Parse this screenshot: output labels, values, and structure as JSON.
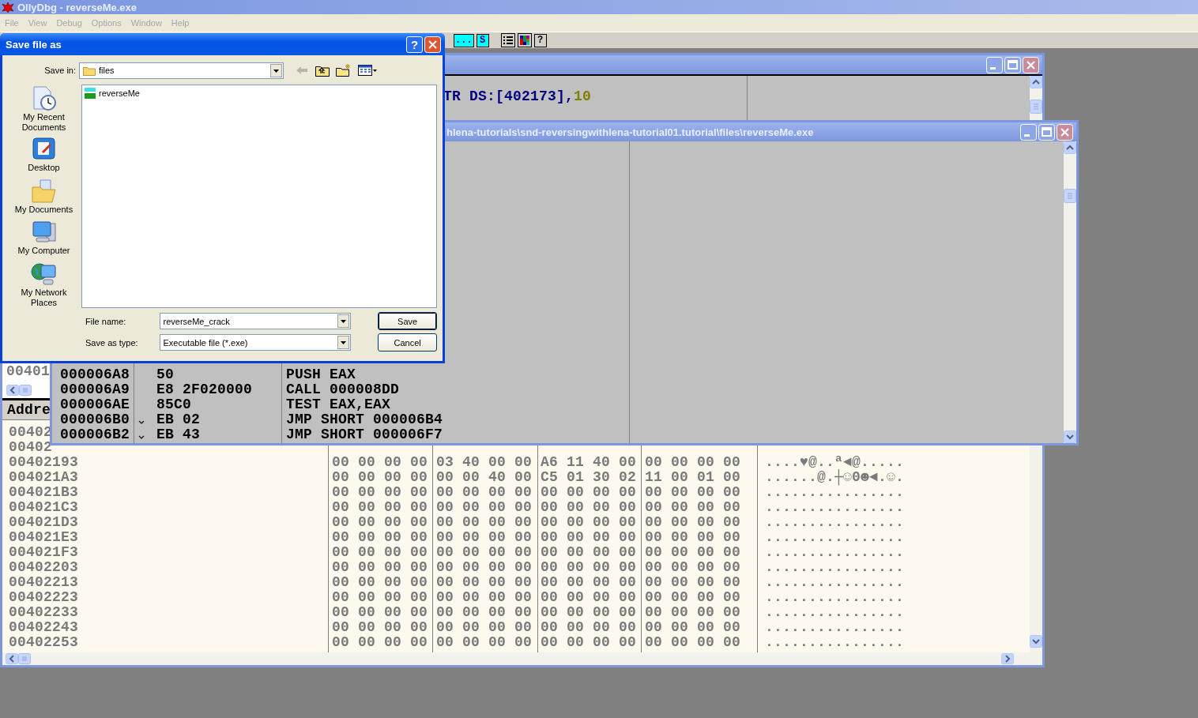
{
  "app": {
    "title": "OllyDbg - reverseMe.exe",
    "menu": [
      "File",
      "View",
      "Debug",
      "Options",
      "Window",
      "Help"
    ],
    "toolbar": [
      {
        "kind": "letter",
        "label": "..."
      },
      {
        "kind": "letter",
        "label": "S"
      },
      {
        "kind": "list"
      },
      {
        "kind": "colors"
      },
      {
        "kind": "help",
        "label": "?"
      }
    ]
  },
  "cpu_window": {
    "disasm_text": "TR DS:[402173],",
    "disasm_const": "10",
    "small_pane_text": "00401",
    "dump_header": "Addre",
    "dump_rows": [
      {
        "address": "00402"
      },
      {
        "address": "00402"
      },
      {
        "address": "00402193",
        "hex": "00 00 00 00 03 40 00 00 A6 11 40 00 00 00 00 00",
        "ascii": "....♥@..ª◄@....."
      },
      {
        "address": "004021A3",
        "hex": "00 00 00 00 00 00 40 00 C5 01 30 02 11 00 01 00",
        "ascii": "......@.┼☺0☻◄.☺."
      },
      {
        "address": "004021B3",
        "hex": "00 00 00 00 00 00 00 00 00 00 00 00 00 00 00 00",
        "ascii": "................"
      },
      {
        "address": "004021C3",
        "hex": "00 00 00 00 00 00 00 00 00 00 00 00 00 00 00 00",
        "ascii": "................"
      },
      {
        "address": "004021D3",
        "hex": "00 00 00 00 00 00 00 00 00 00 00 00 00 00 00 00",
        "ascii": "................"
      },
      {
        "address": "004021E3",
        "hex": "00 00 00 00 00 00 00 00 00 00 00 00 00 00 00 00",
        "ascii": "................"
      },
      {
        "address": "004021F3",
        "hex": "00 00 00 00 00 00 00 00 00 00 00 00 00 00 00 00",
        "ascii": "................"
      },
      {
        "address": "00402203",
        "hex": "00 00 00 00 00 00 00 00 00 00 00 00 00 00 00 00",
        "ascii": "................"
      },
      {
        "address": "00402213",
        "hex": "00 00 00 00 00 00 00 00 00 00 00 00 00 00 00 00",
        "ascii": "................"
      },
      {
        "address": "00402223",
        "hex": "00 00 00 00 00 00 00 00 00 00 00 00 00 00 00 00",
        "ascii": "................"
      },
      {
        "address": "00402233",
        "hex": "00 00 00 00 00 00 00 00 00 00 00 00 00 00 00 00",
        "ascii": "................"
      },
      {
        "address": "00402243",
        "hex": "00 00 00 00 00 00 00 00 00 00 00 00 00 00 00 00",
        "ascii": "................"
      },
      {
        "address": "00402253",
        "hex": "00 00 00 00 00 00 00 00 00 00 00 00 00 00 00 00",
        "ascii": "................"
      }
    ]
  },
  "file_window": {
    "title": "hlena-tutorials\\snd-reversingwithlena-tutorial01.tutorial\\files\\reverseMe.exe",
    "rows": [
      {
        "address": "000006A8",
        "hex": "50",
        "jump": false,
        "command": "PUSH EAX"
      },
      {
        "address": "000006A9",
        "hex": "E8 2F020000",
        "jump": false,
        "command": "CALL 000008DD"
      },
      {
        "address": "000006AE",
        "hex": "85C0",
        "jump": false,
        "command": "TEST EAX,EAX"
      },
      {
        "address": "000006B0",
        "hex": "EB 02",
        "jump": true,
        "command": "JMP SHORT 000006B4"
      },
      {
        "address": "000006B2",
        "hex": "EB 43",
        "jump": true,
        "command": "JMP SHORT 000006F7"
      }
    ]
  },
  "dialog": {
    "title": "Save file as",
    "help": "?",
    "save_in_label": "Save in:",
    "save_in": "files",
    "places": [
      {
        "kind": "recent",
        "label": "My Recent Documents"
      },
      {
        "kind": "desktop",
        "label": "Desktop"
      },
      {
        "kind": "documents",
        "label": "My Documents"
      },
      {
        "kind": "computer",
        "label": "My Computer"
      },
      {
        "kind": "network",
        "label": "My Network Places"
      }
    ],
    "files": [
      {
        "name": "reverseMe",
        "selected": false
      }
    ],
    "file_name_label": "File name:",
    "file_name": "reverseMe_crack",
    "type_label": "Save as type:",
    "type": "Executable file (*.exe)",
    "buttons": [
      "Save",
      "Cancel"
    ]
  }
}
